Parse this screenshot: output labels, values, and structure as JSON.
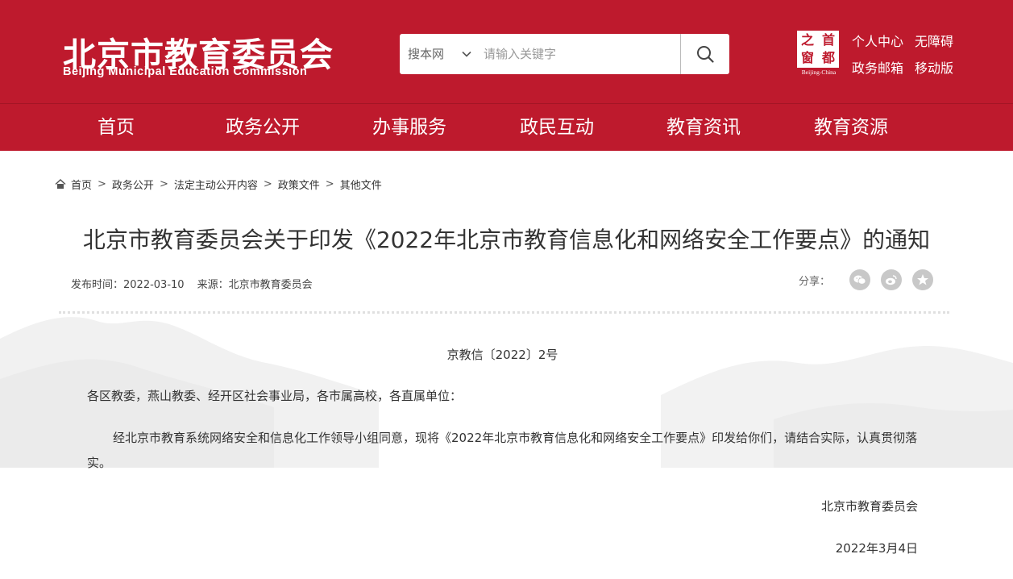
{
  "colors": {
    "brand_red": "#be1a2d",
    "text": "#333333",
    "share_icon_bg": "#c8c8c8"
  },
  "header": {
    "logo_cn": "北京市教育委员会",
    "logo_en": "Beijing Municipal Education Commission",
    "search": {
      "scope": "搜本网",
      "placeholder": "请输入关键字",
      "button_icon": "search-icon"
    },
    "seal": {
      "chars": [
        "之",
        "首",
        "窗",
        "都"
      ],
      "en": "Beijing-China"
    },
    "links": {
      "personal": "个人中心",
      "accessibility": "无障碍",
      "mailbox": "政务邮箱",
      "mobile": "移动版"
    }
  },
  "nav": [
    "首页",
    "政务公开",
    "办事服务",
    "政民互动",
    "教育资讯",
    "教育资源"
  ],
  "breadcrumb": [
    "首页",
    "政务公开",
    "法定主动公开内容",
    "政策文件",
    "其他文件"
  ],
  "article": {
    "title": "北京市教育委员会关于印发《2022年北京市教育信息化和网络安全工作要点》的通知",
    "publish_label": "发布时间：",
    "publish_date": "2022-03-10",
    "source_label": "来源：",
    "source": "北京市教育委员会",
    "share_label": "分享：",
    "share_icons": [
      "wechat-icon",
      "weibo-icon",
      "favorite-star-icon"
    ],
    "doc_number": "京教信〔2022〕2号",
    "addressee": "各区教委，燕山教委、经开区社会事业局，各市属高校，各直属单位：",
    "body": "经北京市教育系统网络安全和信息化工作领导小组同意，现将《2022年北京市教育信息化和网络安全工作要点》印发给你们，请结合实际，认真贯彻落实。",
    "signature": "北京市教育委员会",
    "sign_date": "2022年3月4日"
  }
}
